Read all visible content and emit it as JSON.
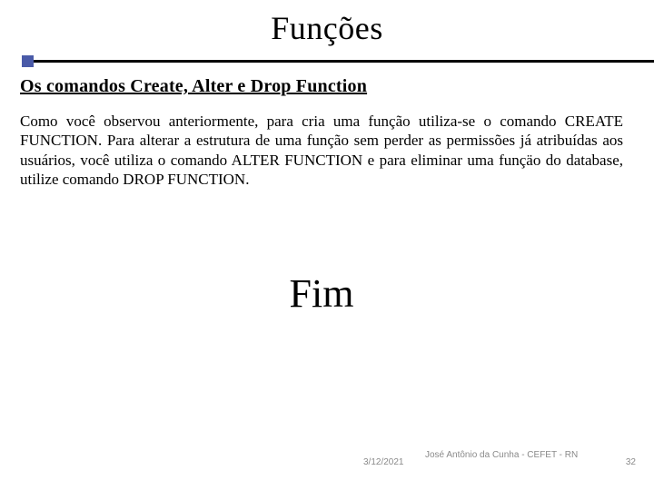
{
  "title": "Funções",
  "subtitle": "Os comandos Create, Alter e Drop Function",
  "body": "Como você observou anteriormente, para cria uma função utiliza-se o comando CREATE FUNCTION. Para alterar a estrutura de uma função sem perder as permissões já atribuídas aos usuários, você utiliza o comando ALTER FUNCTION e para eliminar uma funçäo do database, utilize  comando DROP FUNCTION.",
  "closing": "Fim",
  "footer": {
    "date": "3/12/2021",
    "author": "José Antônio da Cunha - CEFET - RN",
    "page": "32"
  }
}
